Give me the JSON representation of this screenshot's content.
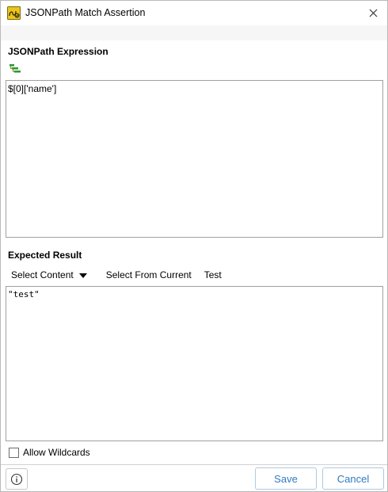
{
  "window": {
    "title": "JSONPath Match Assertion"
  },
  "expression": {
    "section_title": "JSONPath Expression",
    "value": "$[0]['name']"
  },
  "expected": {
    "section_title": "Expected Result",
    "select_content_label": "Select Content",
    "select_from_current_label": "Select From Current",
    "test_label": "Test",
    "value": "\"test\""
  },
  "options": {
    "allow_wildcards_label": "Allow Wildcards",
    "allow_wildcards_checked": false
  },
  "footer": {
    "save_label": "Save",
    "cancel_label": "Cancel"
  },
  "colors": {
    "accent": "#2f7bbf",
    "button_border": "#adc9e2",
    "toolbar_strip": "#f6f6f6"
  },
  "icons": {
    "app": "jsonpath-assertion-icon",
    "close": "close-icon",
    "tree": "tree-select-icon",
    "dropdown": "caret-down-icon",
    "info": "info-icon"
  }
}
